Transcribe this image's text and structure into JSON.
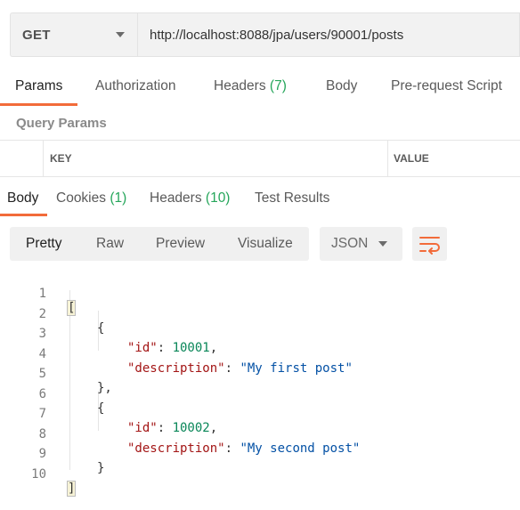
{
  "request": {
    "method": "GET",
    "url": "http://localhost:8088/jpa/users/90001/posts"
  },
  "request_tabs": [
    {
      "label": "Params",
      "count": ""
    },
    {
      "label": "Authorization",
      "count": ""
    },
    {
      "label": "Headers",
      "count": "(7)"
    },
    {
      "label": "Body",
      "count": ""
    },
    {
      "label": "Pre-request Script",
      "count": ""
    }
  ],
  "query_params": {
    "title": "Query Params",
    "columns": [
      "KEY",
      "VALUE"
    ]
  },
  "response_tabs": [
    {
      "label": "Body",
      "count": ""
    },
    {
      "label": "Cookies",
      "count": "(1)"
    },
    {
      "label": "Headers",
      "count": "(10)"
    },
    {
      "label": "Test Results",
      "count": ""
    }
  ],
  "view_modes": [
    "Pretty",
    "Raw",
    "Preview",
    "Visualize"
  ],
  "format": "JSON",
  "code": {
    "line_numbers": [
      "1",
      "2",
      "3",
      "4",
      "5",
      "6",
      "7",
      "8",
      "9",
      "10"
    ],
    "bracket_open": "[",
    "bracket_close": "]",
    "brace_open": "{",
    "brace_close": "}",
    "brace_close_comma": "},",
    "key_id": "\"id\"",
    "key_description": "\"description\"",
    "colon": ": ",
    "comma": ",",
    "id_1": "10001",
    "desc_1": "\"My first post\"",
    "id_2": "10002",
    "desc_2": "\"My second post\""
  },
  "colors": {
    "accent": "#f26b3a",
    "count_green": "#26a65b",
    "json_key": "#a31515",
    "json_number": "#098658",
    "json_string": "#0451a5"
  }
}
